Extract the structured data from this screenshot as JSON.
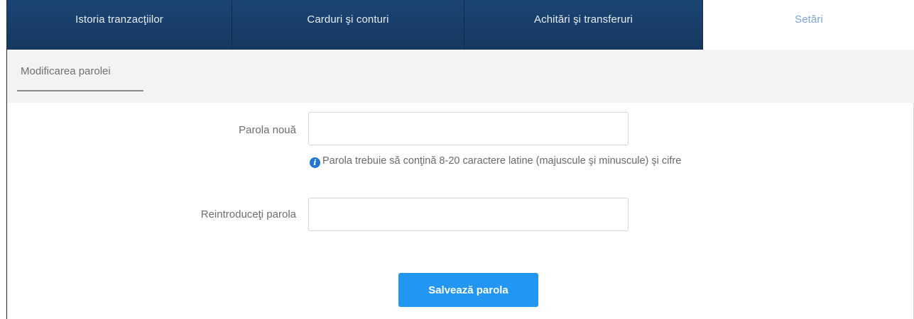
{
  "nav": {
    "tabs": [
      {
        "label": "Istoria tranzacţiilor"
      },
      {
        "label": "Carduri şi conturi"
      },
      {
        "label": "Achitări şi transferuri"
      },
      {
        "label": "Setări"
      }
    ],
    "active_tab": "Setări"
  },
  "subnav": {
    "tab_label": "Modificarea parolei"
  },
  "form": {
    "new_password": {
      "label": "Parola nouă",
      "value": ""
    },
    "hint": {
      "icon": "info-icon",
      "text": "Parola trebuie să conţină 8-20 caractere latine (majuscule şi minuscule) şi cifre"
    },
    "repeat_password": {
      "label": "Reintroduceţi parola",
      "value": ""
    },
    "save_label": "Salvează parola"
  },
  "colors": {
    "nav_bg": "#1b4574",
    "active_tab_text": "#7aa3d6",
    "button": "#2196f3",
    "info_icon": "#1f74d4"
  }
}
